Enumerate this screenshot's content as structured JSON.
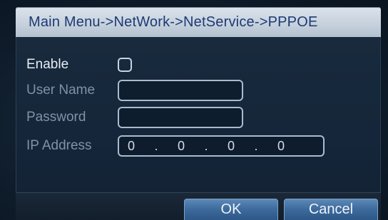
{
  "title": "Main Menu->NetWork->NetService->PPPOE",
  "form": {
    "enable_label": "Enable",
    "enable_checked": false,
    "username_label": "User Name",
    "username_value": "",
    "password_label": "Password",
    "password_value": "",
    "ip_label": "IP Address",
    "ip_octets": [
      "0",
      "0",
      "0",
      "0"
    ],
    "ip_separator": "."
  },
  "buttons": {
    "ok_label": "OK",
    "cancel_label": "Cancel"
  },
  "colors": {
    "title_bar": "#c5d0dc",
    "title_text": "#1d3a74",
    "panel": "#15263a",
    "button": "#3e6c9e"
  }
}
